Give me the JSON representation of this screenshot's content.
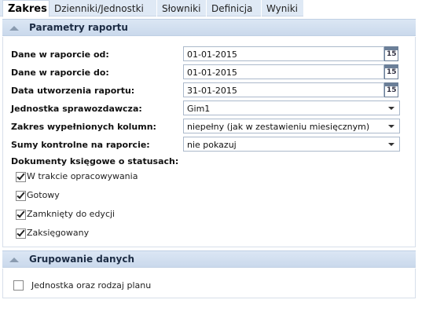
{
  "tabs": [
    {
      "label": "Zakres",
      "active": true
    },
    {
      "label": "Dzienniki/Jednostki"
    },
    {
      "label": "Słowniki"
    },
    {
      "label": "Definicja"
    },
    {
      "label": "Wyniki"
    }
  ],
  "report_params": {
    "title": "Parametry raportu",
    "date_from_label": "Dane w raporcie od:",
    "date_from_value": "01-01-2015",
    "date_to_label": "Dane w raporcie do:",
    "date_to_value": "01-01-2015",
    "created_label": "Data utworzenia raportu:",
    "created_value": "31-01-2015",
    "calendar_day": "15",
    "unit_label": "Jednostka sprawozdawcza:",
    "unit_value": "Gim1",
    "columns_label": "Zakres wypełnionych kolumn:",
    "columns_value": "niepełny (jak w zestawieniu miesięcznym)",
    "checksums_label": "Sumy kontrolne na raporcie:",
    "checksums_value": "nie pokazuj",
    "statuses_label": "Dokumenty księgowe o statusach:",
    "statuses": [
      {
        "label": "W trakcie opracowywania",
        "checked": true
      },
      {
        "label": "Gotowy",
        "checked": true
      },
      {
        "label": "Zamknięty do edycji",
        "checked": true
      },
      {
        "label": "Zaksięgowany",
        "checked": true
      }
    ]
  },
  "grouping": {
    "title": "Grupowanie danych",
    "option_label": "Jednostka oraz rodzaj planu",
    "option_checked": false
  },
  "colors": {
    "header_bg": "#cad9ec",
    "tab_bg": "#dfe9f5",
    "field_border": "#abb9cb"
  }
}
